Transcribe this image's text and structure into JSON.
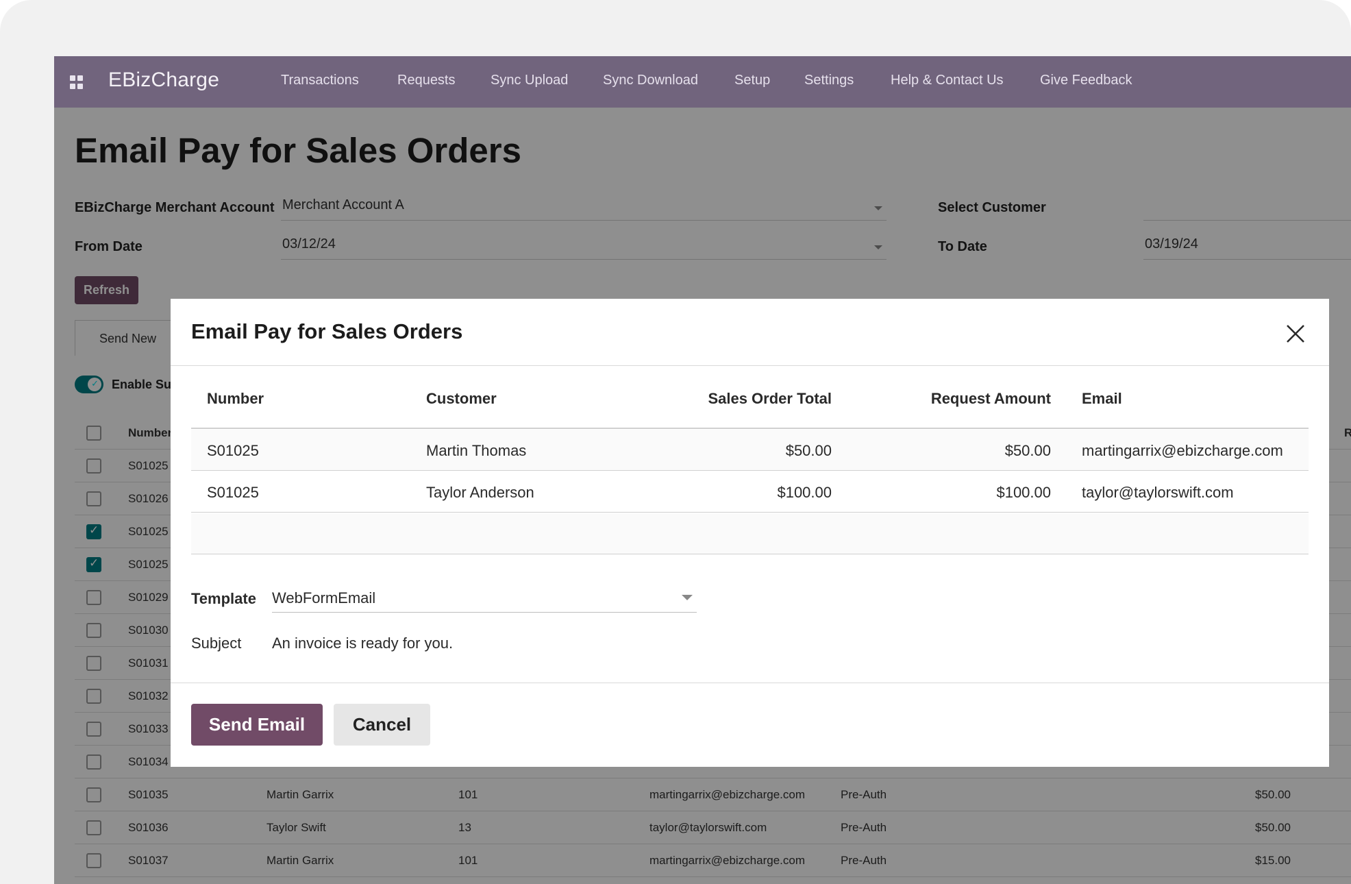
{
  "navbar": {
    "brand": "EBizCharge",
    "items": [
      "Transactions",
      "Requests",
      "Sync Upload",
      "Sync Download",
      "Setup",
      "Settings",
      "Help & Contact Us",
      "Give Feedback"
    ]
  },
  "page": {
    "title": "Email Pay for Sales Orders",
    "merchant_label": "EBizCharge Merchant Account",
    "merchant_value": "Merchant Account A",
    "customer_label": "Select Customer",
    "customer_value": "",
    "from_label": "From Date",
    "from_value": "03/12/24",
    "to_label": "To Date",
    "to_value": "03/19/24",
    "refresh_label": "Refresh",
    "tab_label": "Send New",
    "toggle_label": "Enable Su",
    "toggle_on": true
  },
  "bg_table": {
    "header": "Number",
    "header_extra": "R",
    "rows": [
      {
        "number": "S01025",
        "checked": false
      },
      {
        "number": "S01026",
        "checked": false
      },
      {
        "number": "S01025",
        "checked": true
      },
      {
        "number": "S01025",
        "checked": true
      },
      {
        "number": "S01029",
        "checked": false
      },
      {
        "number": "S01030",
        "checked": false
      },
      {
        "number": "S01031",
        "checked": false
      },
      {
        "number": "S01032",
        "checked": false
      },
      {
        "number": "S01033",
        "checked": false
      },
      {
        "number": "S01034",
        "checked": false
      },
      {
        "number": "S01035",
        "checked": false,
        "customer": "Martin Garrix",
        "id": "101",
        "email": "martingarrix@ebizcharge.com",
        "type": "Pre-Auth",
        "amount": "$50.00"
      },
      {
        "number": "S01036",
        "checked": false,
        "customer": "Taylor Swift",
        "id": "13",
        "email": "taylor@taylorswift.com",
        "type": "Pre-Auth",
        "amount": "$50.00"
      },
      {
        "number": "S01037",
        "checked": false,
        "customer": "Martin Garrix",
        "id": "101",
        "email": "martingarrix@ebizcharge.com",
        "type": "Pre-Auth",
        "amount": "$15.00"
      }
    ]
  },
  "modal": {
    "title": "Email Pay for Sales Orders",
    "columns": {
      "number": "Number",
      "customer": "Customer",
      "total": "Sales Order Total",
      "request": "Request Amount",
      "email": "Email"
    },
    "rows": [
      {
        "number": "S01025",
        "customer": "Martin Thomas",
        "total": "$50.00",
        "request": "$50.00",
        "email": "martingarrix@ebizcharge.com"
      },
      {
        "number": "S01025",
        "customer": "Taylor Anderson",
        "total": "$100.00",
        "request": "$100.00",
        "email": "taylor@taylorswift.com"
      }
    ],
    "template_label": "Template",
    "template_value": "WebFormEmail",
    "subject_label": "Subject",
    "subject_value": "An invoice is ready for you.",
    "send_label": "Send Email",
    "cancel_label": "Cancel"
  },
  "colors": {
    "navbar": "#71647d",
    "primary": "#714b67",
    "toggle": "#017e84"
  }
}
